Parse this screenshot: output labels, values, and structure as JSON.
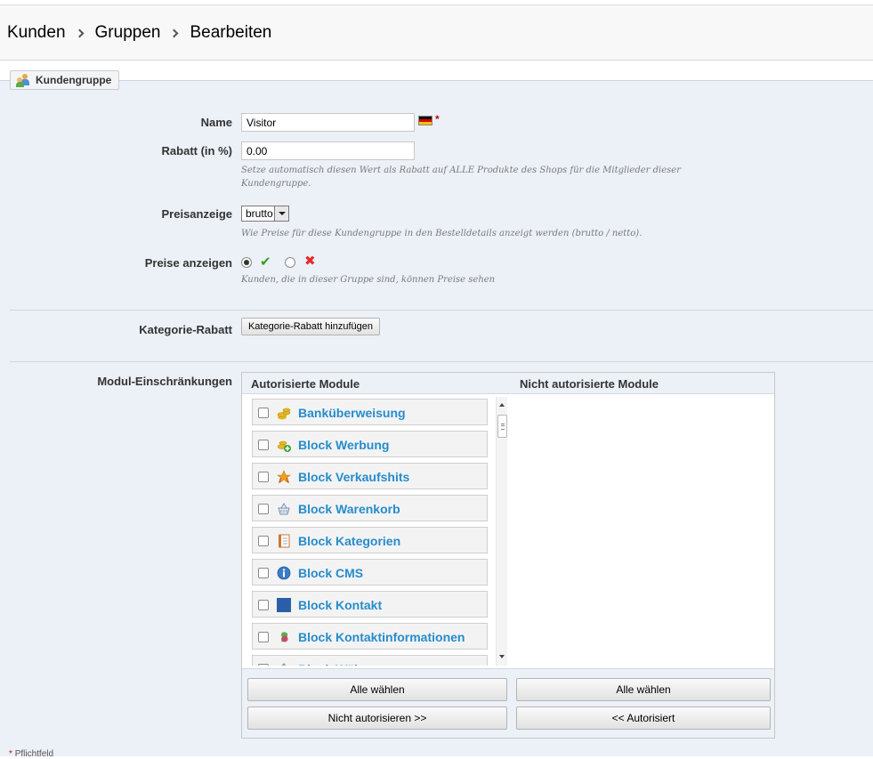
{
  "breadcrumb": [
    "Kunden",
    "Gruppen",
    "Bearbeiten"
  ],
  "legend": {
    "icon": "customer-group-icon",
    "title": "Kundengruppe"
  },
  "form": {
    "name": {
      "label": "Name",
      "value": "Visitor",
      "required_mark": "*"
    },
    "discount": {
      "label": "Rabatt (in %)",
      "value": "0.00",
      "hint_line1": "Setze automatisch diesen Wert als Rabatt auf ALLE Produkte des Shops für die Mitglieder dieser",
      "hint_line2": "Kundengruppe."
    },
    "price_display": {
      "label": "Preisanzeige",
      "selected": "brutto",
      "hint": "Wie Preise für diese Kundengruppe in den Bestelldetails anzeigt werden (brutto / netto)."
    },
    "show_prices": {
      "label": "Preise anzeigen",
      "value": "yes",
      "hint": "Kunden, die in dieser Gruppe sind, können Preise sehen"
    },
    "category_discount": {
      "label": "Kategorie-Rabatt",
      "button": "Kategorie-Rabatt hinzufügen"
    },
    "module_restrictions": {
      "label": "Modul-Einschränkungen",
      "authorized_header": "Autorisierte Module",
      "unauthorized_header": "Nicht autorisierte Module",
      "modules": [
        {
          "name": "Banküberweisung",
          "icon": "coins-icon",
          "color": "#e6b820"
        },
        {
          "name": "Block Werbung",
          "icon": "coins-add-icon",
          "color": "#e6b820"
        },
        {
          "name": "Block Verkaufshits",
          "icon": "award-star-icon",
          "color": "#f0a020"
        },
        {
          "name": "Block Warenkorb",
          "icon": "basket-icon",
          "color": "#7a90b0"
        },
        {
          "name": "Block Kategorien",
          "icon": "book-open-icon",
          "color": "#c87a30"
        },
        {
          "name": "Block CMS",
          "icon": "information-icon",
          "color": "#3a7cc8"
        },
        {
          "name": "Block Kontakt",
          "icon": "contact-square-icon",
          "color": "#2a5fa8"
        },
        {
          "name": "Block Kontaktinformationen",
          "icon": "contact-info-icon",
          "color": "#c84a6a"
        },
        {
          "name": "Block Währung",
          "icon": "currency-icon",
          "color": "#9aa0a8"
        }
      ],
      "select_all_left": "Alle wählen",
      "select_all_right": "Alle wählen",
      "unauthorize": "Nicht autorisieren >>",
      "authorize": "<< Autorisiert"
    }
  },
  "footer": {
    "required_note_star": "*",
    "required_note": "Pflichtfeld"
  }
}
